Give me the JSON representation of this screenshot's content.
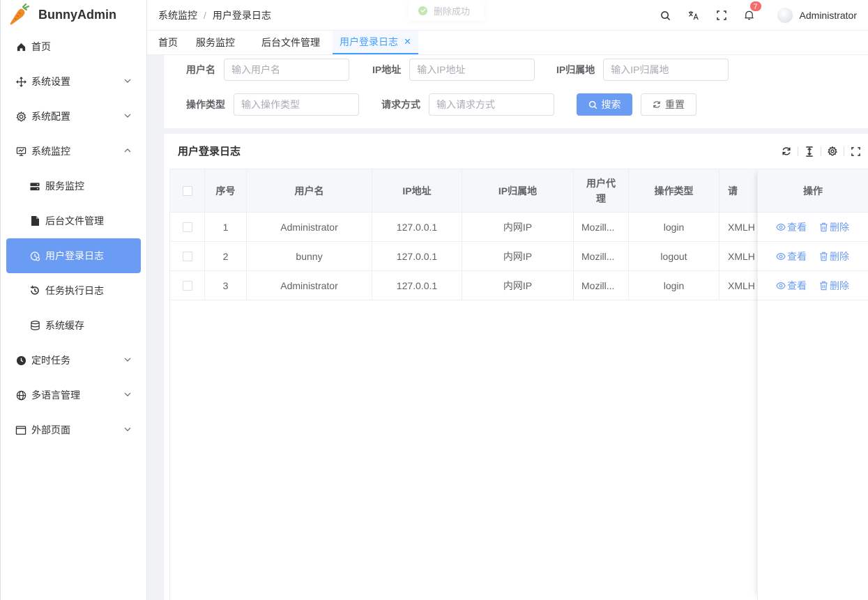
{
  "app": {
    "name": "BunnyAdmin"
  },
  "sidebar": {
    "items": [
      {
        "label": "首页"
      },
      {
        "label": "系统设置"
      },
      {
        "label": "系统配置"
      },
      {
        "label": "系统监控"
      },
      {
        "label": "服务监控"
      },
      {
        "label": "后台文件管理"
      },
      {
        "label": "用户登录日志"
      },
      {
        "label": "任务执行日志"
      },
      {
        "label": "系统缓存"
      },
      {
        "label": "定时任务"
      },
      {
        "label": "多语言管理"
      },
      {
        "label": "外部页面"
      }
    ]
  },
  "header": {
    "breadcrumb": [
      "系统监控",
      "用户登录日志"
    ],
    "separator": "/",
    "notification_count": "7",
    "user_name": "Administrator"
  },
  "toast": {
    "message": "删除成功"
  },
  "tabs": [
    {
      "label": "首页"
    },
    {
      "label": "服务监控"
    },
    {
      "label": "后台文件管理"
    },
    {
      "label": "用户登录日志"
    }
  ],
  "search": {
    "username": {
      "label": "用户名",
      "placeholder": "输入用户名"
    },
    "ip": {
      "label": "IP地址",
      "placeholder": "输入IP地址"
    },
    "location": {
      "label": "IP归属地",
      "placeholder": "输入IP归属地"
    },
    "op_type": {
      "label": "操作类型",
      "placeholder": "输入操作类型"
    },
    "method": {
      "label": "请求方式",
      "placeholder": "输入请求方式"
    },
    "search_label": "搜索",
    "reset_label": "重置"
  },
  "table": {
    "title": "用户登录日志",
    "columns": [
      "序号",
      "用户名",
      "IP地址",
      "IP归属地",
      "用户代理",
      "操作类型",
      "请",
      "操作"
    ],
    "rows": [
      {
        "idx": "1",
        "user": "Administrator",
        "ip": "127.0.0.1",
        "loc": "内网IP",
        "agent": "Mozill...",
        "op": "login",
        "req": "XMLH"
      },
      {
        "idx": "2",
        "user": "bunny",
        "ip": "127.0.0.1",
        "loc": "内网IP",
        "agent": "Mozill...",
        "op": "logout",
        "req": "XMLH"
      },
      {
        "idx": "3",
        "user": "Administrator",
        "ip": "127.0.0.1",
        "loc": "内网IP",
        "agent": "Mozill...",
        "op": "login",
        "req": "XMLH"
      }
    ],
    "action_view": "查看",
    "action_delete": "删除"
  },
  "colors": {
    "primary": "#409eff",
    "active_menu": "#6b9cf4",
    "danger": "#f56c6c"
  }
}
